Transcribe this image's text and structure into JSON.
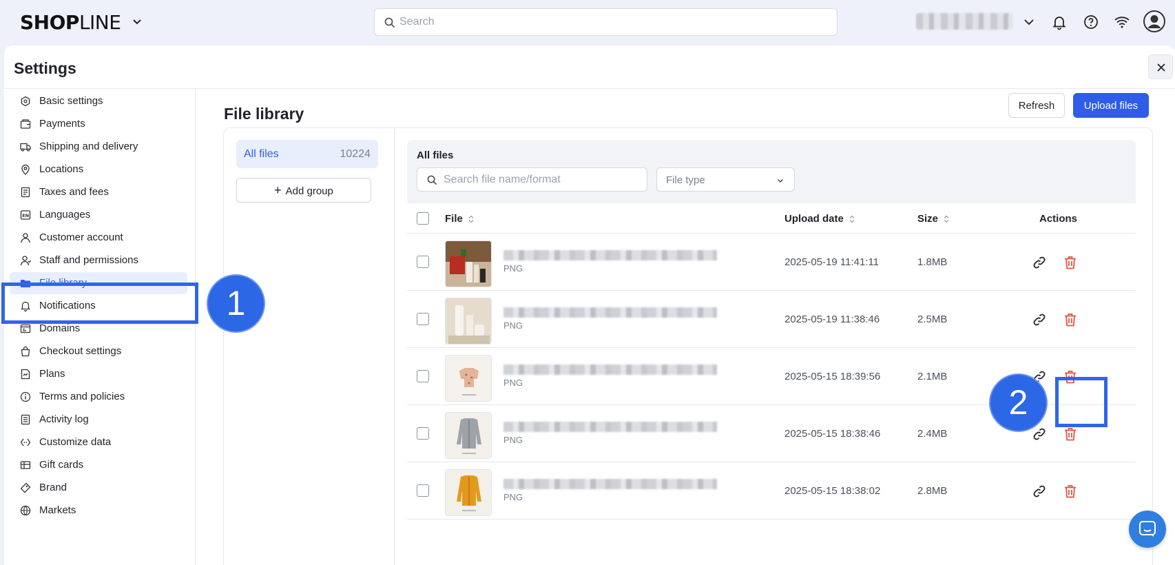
{
  "brand": {
    "logo_bold": "SHOP",
    "logo_light": "LINE"
  },
  "search": {
    "placeholder": "Search"
  },
  "settings": {
    "title": "Settings"
  },
  "sidebar": {
    "items": [
      {
        "label": "Basic settings",
        "icon": "gear-hex-icon"
      },
      {
        "label": "Payments",
        "icon": "wallet-icon"
      },
      {
        "label": "Shipping and delivery",
        "icon": "truck-icon"
      },
      {
        "label": "Locations",
        "icon": "location-pin-icon"
      },
      {
        "label": "Taxes and fees",
        "icon": "receipt-icon"
      },
      {
        "label": "Languages",
        "icon": "language-icon"
      },
      {
        "label": "Customer account",
        "icon": "user-icon"
      },
      {
        "label": "Staff and permissions",
        "icon": "staff-icon"
      },
      {
        "label": "File library",
        "icon": "folder-icon",
        "active": true
      },
      {
        "label": "Notifications",
        "icon": "bell-icon"
      },
      {
        "label": "Domains",
        "icon": "domain-icon"
      },
      {
        "label": "Checkout settings",
        "icon": "bag-icon"
      },
      {
        "label": "Plans",
        "icon": "plans-icon"
      },
      {
        "label": "Terms and policies",
        "icon": "info-icon"
      },
      {
        "label": "Activity log",
        "icon": "log-icon"
      },
      {
        "label": "Customize data",
        "icon": "code-icon"
      },
      {
        "label": "Gift cards",
        "icon": "gift-card-icon"
      },
      {
        "label": "Brand",
        "icon": "brand-icon"
      },
      {
        "label": "Markets",
        "icon": "globe-icon"
      }
    ]
  },
  "main": {
    "title": "File library",
    "refresh_label": "Refresh",
    "upload_label": "Upload files",
    "groups": {
      "all_label": "All files",
      "all_count": "10224",
      "add_group_label": "Add group"
    },
    "files": {
      "title": "All files",
      "search_placeholder": "Search file name/format",
      "file_type_label": "File type",
      "columns": {
        "file": "File",
        "upload_date": "Upload date",
        "size": "Size",
        "actions": "Actions"
      },
      "rows": [
        {
          "type": "PNG",
          "date": "2025-05-19 11:41:11",
          "size": "1.8MB",
          "thumb": "gift-bottles"
        },
        {
          "type": "PNG",
          "date": "2025-05-19 11:38:46",
          "size": "2.5MB",
          "thumb": "white-bottles"
        },
        {
          "type": "PNG",
          "date": "2025-05-15 18:39:56",
          "size": "2.1MB",
          "thumb": "floral-top"
        },
        {
          "type": "PNG",
          "date": "2025-05-15 18:38:46",
          "size": "2.4MB",
          "thumb": "grey-cardigan"
        },
        {
          "type": "PNG",
          "date": "2025-05-15 18:38:02",
          "size": "2.8MB",
          "thumb": "yellow-cardigan"
        }
      ]
    }
  },
  "annotations": {
    "step1": "1",
    "step2": "2"
  },
  "colors": {
    "accent": "#2f5ce9",
    "annotation": "#2c67e6",
    "delete": "#e5533d"
  }
}
